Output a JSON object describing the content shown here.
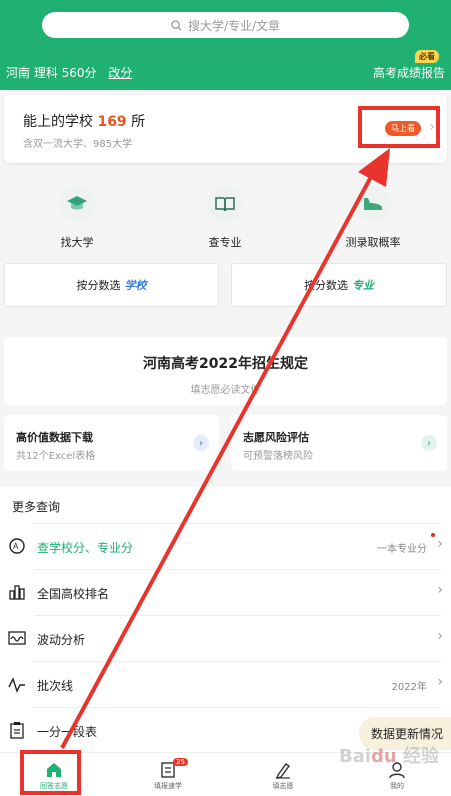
{
  "header": {
    "search_placeholder": "搜大学/专业/文章",
    "province_info": "河南 理科 560分",
    "edit_label": "改分",
    "report_label": "高考成绩报告",
    "must_badge": "必看"
  },
  "main_card": {
    "title_prefix": "能上的学校",
    "count": "169",
    "title_suffix": "所",
    "subtitle": "含双一流大学、985大学",
    "look_button": "马上看"
  },
  "tools": [
    {
      "label": "找大学",
      "icon": "mortarboard-icon"
    },
    {
      "label": "查专业",
      "icon": "book-icon"
    },
    {
      "label": "测录取概率",
      "icon": "shoe-icon"
    }
  ],
  "select_school": {
    "prefix": "按分数选",
    "accent": "学校"
  },
  "select_major": {
    "prefix": "按分数选",
    "accent": "专业"
  },
  "banner": {
    "title": "河南高考2022年招生规定",
    "subtitle": "填志愿必读文件"
  },
  "data_card": {
    "title": "高价值数据下载",
    "subtitle": "共12个Excel表格"
  },
  "risk_card": {
    "title": "志愿风险评估",
    "subtitle": "可预警落榜风险"
  },
  "more": {
    "title": "更多查询",
    "items": [
      {
        "label": "查学校分、专业分",
        "right": "一本专业分"
      },
      {
        "label": "全国高校排名",
        "right": ""
      },
      {
        "label": "波动分析",
        "right": ""
      },
      {
        "label": "批次线",
        "right": "2022年"
      },
      {
        "label": "一分一段表",
        "right": ""
      }
    ]
  },
  "update_pill": "数据更新情况",
  "nav": [
    {
      "label": "回答志愿",
      "badge": ""
    },
    {
      "label": "填报速学",
      "badge": "25"
    },
    {
      "label": "填志愿",
      "badge": ""
    },
    {
      "label": "我的",
      "badge": ""
    }
  ],
  "watermark": "Baidu 经验",
  "colors": {
    "brand": "#1fb072",
    "accent": "#e8541c",
    "annotation": "#e8342d"
  }
}
